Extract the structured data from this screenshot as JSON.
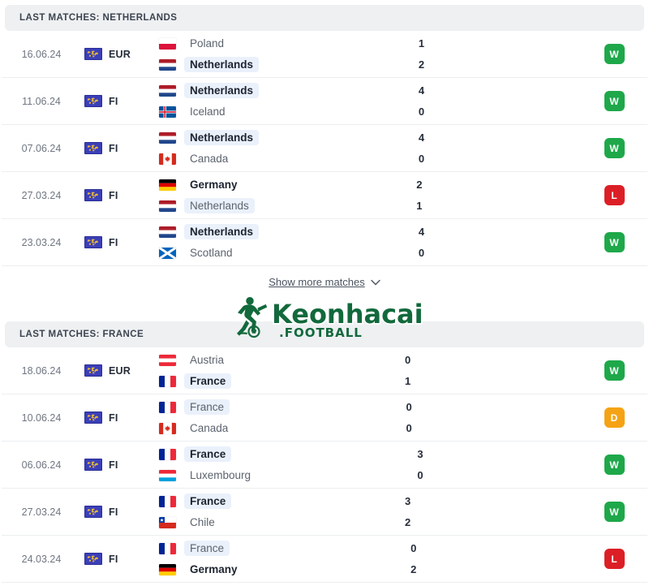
{
  "colors": {
    "win": "#1ea84a",
    "loss": "#dc1f26",
    "draw": "#f5a314",
    "header_bg": "#eef0f2",
    "highlight": "#eaf1fb",
    "watermark": "#12693c"
  },
  "sections": [
    {
      "header": "LAST MATCHES: NETHERLANDS",
      "matches": [
        {
          "date": "16.06.24",
          "competition": "EUR",
          "competition_icon": "world-globe-icon",
          "home": {
            "team": "Poland",
            "flag": "pl",
            "score": "1",
            "bold": false,
            "highlight": false
          },
          "away": {
            "team": "Netherlands",
            "flag": "nl",
            "score": "2",
            "bold": true,
            "highlight": true
          },
          "result": "W"
        },
        {
          "date": "11.06.24",
          "competition": "FI",
          "competition_icon": "world-globe-icon",
          "home": {
            "team": "Netherlands",
            "flag": "nl",
            "score": "4",
            "bold": true,
            "highlight": true
          },
          "away": {
            "team": "Iceland",
            "flag": "is",
            "score": "0",
            "bold": false,
            "highlight": false
          },
          "result": "W"
        },
        {
          "date": "07.06.24",
          "competition": "FI",
          "competition_icon": "world-globe-icon",
          "home": {
            "team": "Netherlands",
            "flag": "nl",
            "score": "4",
            "bold": true,
            "highlight": true
          },
          "away": {
            "team": "Canada",
            "flag": "ca",
            "score": "0",
            "bold": false,
            "highlight": false
          },
          "result": "W"
        },
        {
          "date": "27.03.24",
          "competition": "FI",
          "competition_icon": "world-globe-icon",
          "home": {
            "team": "Germany",
            "flag": "de",
            "score": "2",
            "bold": true,
            "highlight": false
          },
          "away": {
            "team": "Netherlands",
            "flag": "nl",
            "score": "1",
            "bold": false,
            "highlight": true
          },
          "result": "L"
        },
        {
          "date": "23.03.24",
          "competition": "FI",
          "competition_icon": "world-globe-icon",
          "home": {
            "team": "Netherlands",
            "flag": "nl",
            "score": "4",
            "bold": true,
            "highlight": true
          },
          "away": {
            "team": "Scotland",
            "flag": "sc",
            "score": "0",
            "bold": false,
            "highlight": false
          },
          "result": "W"
        }
      ],
      "show_more": "Show more matches"
    },
    {
      "header": "LAST MATCHES: FRANCE",
      "matches": [
        {
          "date": "18.06.24",
          "competition": "EUR",
          "competition_icon": "world-globe-icon",
          "home": {
            "team": "Austria",
            "flag": "at",
            "score": "0",
            "bold": false,
            "highlight": false
          },
          "away": {
            "team": "France",
            "flag": "fr",
            "score": "1",
            "bold": true,
            "highlight": true
          },
          "result": "W"
        },
        {
          "date": "10.06.24",
          "competition": "FI",
          "competition_icon": "world-globe-icon",
          "home": {
            "team": "France",
            "flag": "fr",
            "score": "0",
            "bold": false,
            "highlight": true
          },
          "away": {
            "team": "Canada",
            "flag": "ca",
            "score": "0",
            "bold": false,
            "highlight": false
          },
          "result": "D"
        },
        {
          "date": "06.06.24",
          "competition": "FI",
          "competition_icon": "world-globe-icon",
          "home": {
            "team": "France",
            "flag": "fr",
            "score": "3",
            "bold": true,
            "highlight": true
          },
          "away": {
            "team": "Luxembourg",
            "flag": "lu",
            "score": "0",
            "bold": false,
            "highlight": false
          },
          "result": "W"
        },
        {
          "date": "27.03.24",
          "competition": "FI",
          "competition_icon": "world-globe-icon",
          "home": {
            "team": "France",
            "flag": "fr",
            "score": "3",
            "bold": true,
            "highlight": true
          },
          "away": {
            "team": "Chile",
            "flag": "cl",
            "score": "2",
            "bold": false,
            "highlight": false
          },
          "result": "W"
        },
        {
          "date": "24.03.24",
          "competition": "FI",
          "competition_icon": "world-globe-icon",
          "home": {
            "team": "France",
            "flag": "fr",
            "score": "0",
            "bold": false,
            "highlight": true
          },
          "away": {
            "team": "Germany",
            "flag": "de",
            "score": "2",
            "bold": true,
            "highlight": false
          },
          "result": "L"
        }
      ]
    }
  ],
  "watermark": {
    "name": "Keonhacai",
    "suffix": ".FOOTBALL"
  }
}
